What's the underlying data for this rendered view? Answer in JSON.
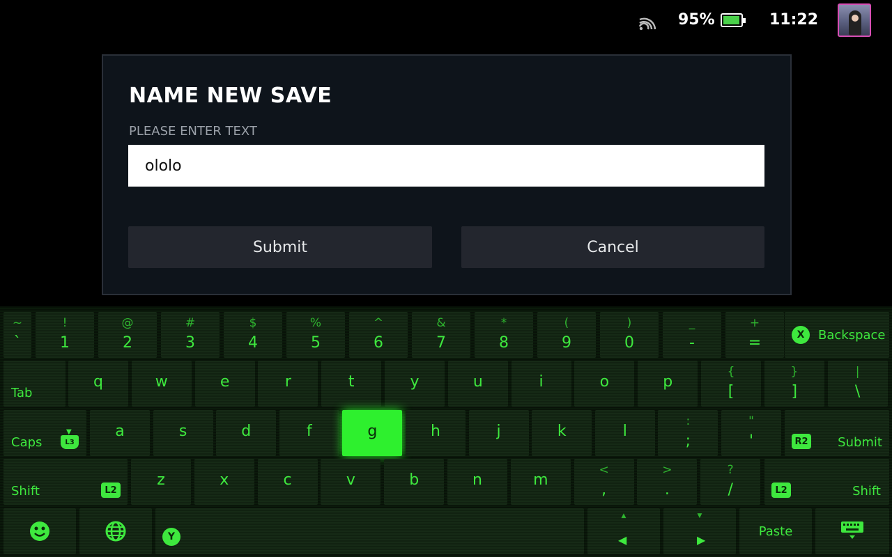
{
  "status_bar": {
    "battery_percent_label": "95%",
    "battery_level": 0.95,
    "time": "11:22",
    "icons": [
      "wifi-icon",
      "battery-icon",
      "avatar"
    ]
  },
  "dialog": {
    "title": "NAME NEW SAVE",
    "label": "PLEASE ENTER TEXT",
    "input_value": "ololo",
    "submit_label": "Submit",
    "cancel_label": "Cancel"
  },
  "keyboard": {
    "row1": [
      {
        "shift": "~",
        "main": "`"
      },
      {
        "shift": "!",
        "main": "1"
      },
      {
        "shift": "@",
        "main": "2"
      },
      {
        "shift": "#",
        "main": "3"
      },
      {
        "shift": "$",
        "main": "4"
      },
      {
        "shift": "%",
        "main": "5"
      },
      {
        "shift": "^",
        "main": "6"
      },
      {
        "shift": "&",
        "main": "7"
      },
      {
        "shift": "*",
        "main": "8"
      },
      {
        "shift": "(",
        "main": "9"
      },
      {
        "shift": ")",
        "main": "0"
      },
      {
        "shift": "_",
        "main": "-"
      },
      {
        "shift": "+",
        "main": "="
      }
    ],
    "backspace_label": "Backspace",
    "backspace_badge": "X",
    "tab_label": "Tab",
    "row2": [
      {
        "main": "q"
      },
      {
        "main": "w"
      },
      {
        "main": "e"
      },
      {
        "main": "r"
      },
      {
        "main": "t"
      },
      {
        "main": "y"
      },
      {
        "main": "u"
      },
      {
        "main": "i"
      },
      {
        "main": "o"
      },
      {
        "main": "p"
      },
      {
        "shift": "{",
        "main": "["
      },
      {
        "shift": "}",
        "main": "]"
      },
      {
        "shift": "|",
        "main": "\\"
      }
    ],
    "caps_label": "Caps",
    "caps_badge": "L3",
    "row3": [
      {
        "main": "a"
      },
      {
        "main": "s"
      },
      {
        "main": "d"
      },
      {
        "main": "f"
      },
      {
        "main": "g"
      },
      {
        "main": "h"
      },
      {
        "main": "j"
      },
      {
        "main": "k"
      },
      {
        "main": "l"
      },
      {
        "shift": ":",
        "main": ";"
      },
      {
        "shift": "\"",
        "main": "'"
      }
    ],
    "active_key": "g",
    "enter_label": "Submit",
    "enter_badge": "R2",
    "shift_label": "Shift",
    "shift_badge": "L2",
    "row4": [
      {
        "main": "z"
      },
      {
        "main": "x"
      },
      {
        "main": "c"
      },
      {
        "main": "v"
      },
      {
        "main": "b"
      },
      {
        "main": "n"
      },
      {
        "main": "m"
      },
      {
        "shift": "<",
        "main": ","
      },
      {
        "shift": ">",
        "main": "."
      },
      {
        "shift": "?",
        "main": "/"
      }
    ],
    "space_badge": "Y",
    "paste_label": "Paste",
    "bottom_icons": [
      "emoji-icon",
      "globe-icon",
      "left-arrow-icon",
      "right-arrow-icon",
      "keyboard-hide-icon"
    ],
    "accent_color": "#3ee83e"
  }
}
